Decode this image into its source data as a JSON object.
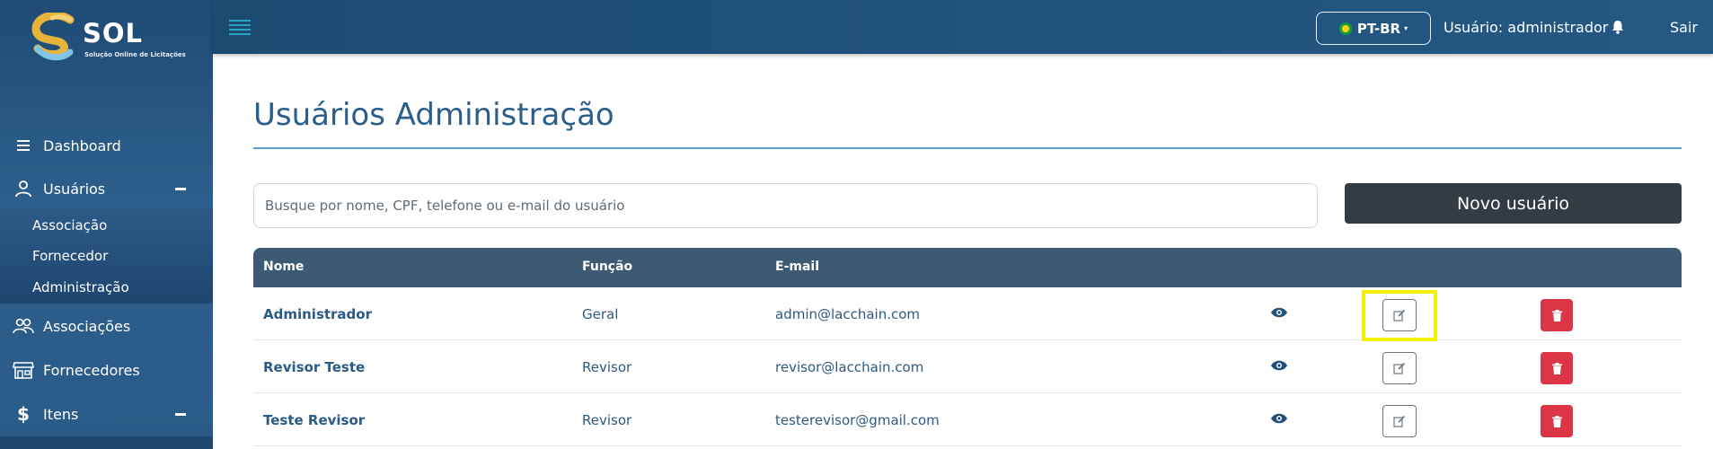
{
  "app": {
    "brand": "SOL",
    "subtitle": "Solução Online de Licitações"
  },
  "topbar": {
    "language": "PT-BR",
    "user_label": "Usuário: administrador",
    "logout": "Sair"
  },
  "sidebar": {
    "items": [
      {
        "label": "Dashboard",
        "icon": "menu-icon"
      },
      {
        "label": "Usuários",
        "icon": "user-icon",
        "expanded": true
      },
      {
        "label": "Associações",
        "icon": "users-group-icon"
      },
      {
        "label": "Fornecedores",
        "icon": "store-icon"
      },
      {
        "label": "Itens",
        "icon": "dollar-icon",
        "expanded": true
      }
    ],
    "usuarios_sub": [
      "Associação",
      "Fornecedor",
      "Administração"
    ]
  },
  "main": {
    "title": "Usuários Administração",
    "search_placeholder": "Busque por nome, CPF, telefone ou e-mail do usuário",
    "new_button": "Novo usuário"
  },
  "table": {
    "columns": [
      "Nome",
      "Função",
      "E-mail"
    ],
    "rows": [
      {
        "name": "Administrador",
        "role": "Geral",
        "email": "admin@lacchain.com"
      },
      {
        "name": "Revisor Teste",
        "role": "Revisor",
        "email": "revisor@lacchain.com"
      },
      {
        "name": "Teste Revisor",
        "role": "Revisor",
        "email": "testerevisor@gmail.com"
      }
    ]
  },
  "colors": {
    "sidebar": "#2a5b88",
    "topbar": "#1f5079",
    "title": "#2b5e8b",
    "table_header": "#3d5a75",
    "new_button": "#333b45",
    "delete": "#dc3545",
    "highlight": "#f4f000"
  }
}
